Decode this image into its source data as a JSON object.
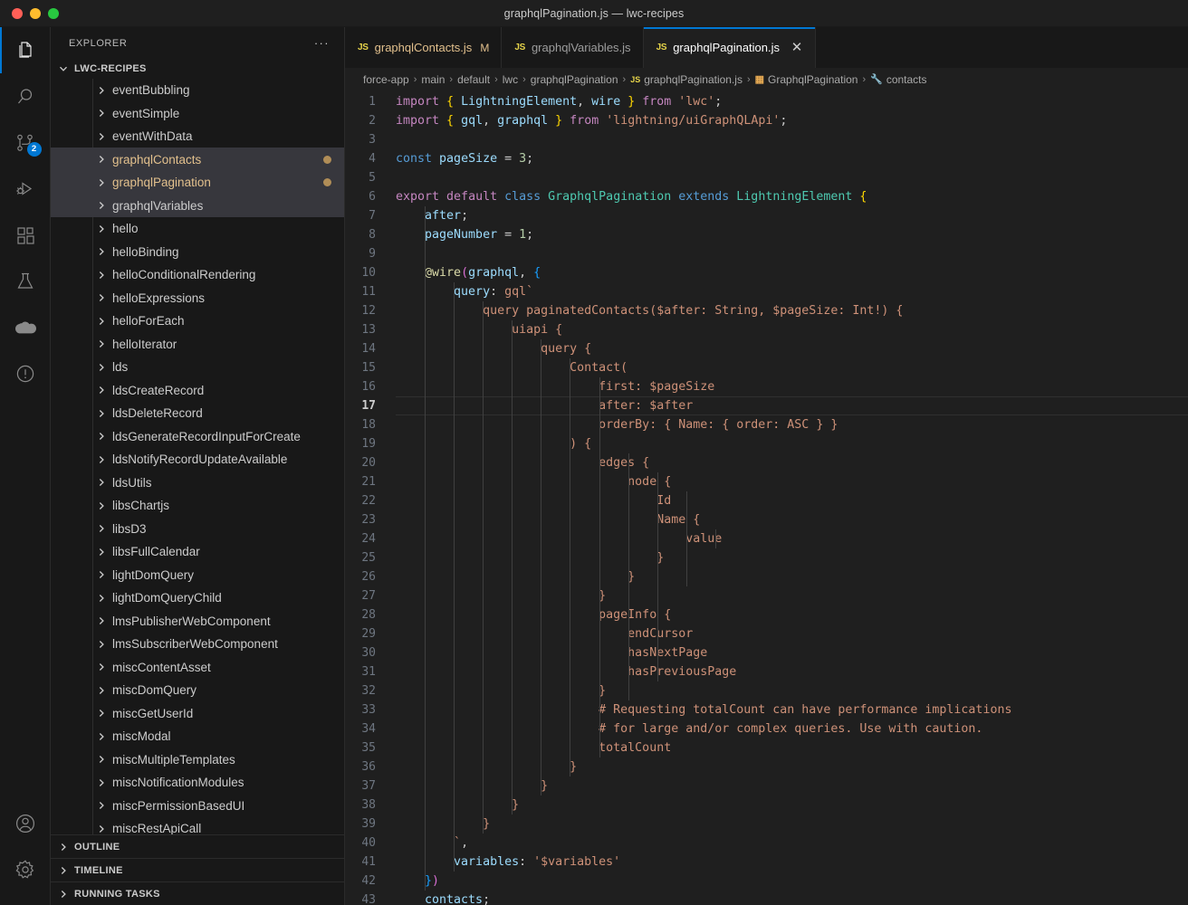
{
  "window": {
    "title": "graphqlPagination.js — lwc-recipes",
    "traffic_lights": [
      "close",
      "minimize",
      "maximize"
    ]
  },
  "activity_bar": {
    "top_items": [
      {
        "name": "explorer",
        "icon": "files-icon",
        "active": true,
        "badge": null
      },
      {
        "name": "search",
        "icon": "search-icon",
        "active": false,
        "badge": null
      },
      {
        "name": "source-control",
        "icon": "source-control-icon",
        "active": false,
        "badge": "2"
      },
      {
        "name": "run-and-debug",
        "icon": "run-debug-icon",
        "active": false,
        "badge": null
      },
      {
        "name": "extensions",
        "icon": "extensions-icon",
        "active": false,
        "badge": null
      },
      {
        "name": "testing",
        "icon": "beaker-icon",
        "active": false,
        "badge": null
      },
      {
        "name": "salesforce",
        "icon": "cloud-icon",
        "active": false,
        "badge": null
      },
      {
        "name": "problems",
        "icon": "warning-circle-icon",
        "active": false,
        "badge": null
      }
    ],
    "bottom_items": [
      {
        "name": "accounts",
        "icon": "account-icon"
      },
      {
        "name": "manage",
        "icon": "gear-icon"
      }
    ]
  },
  "sidebar": {
    "header_title": "EXPLORER",
    "more_actions": "···",
    "root_folder": "LWC-RECIPES",
    "tree_items": [
      {
        "label": "eventBubbling",
        "modified": false,
        "selected": false,
        "dot": false
      },
      {
        "label": "eventSimple",
        "modified": false,
        "selected": false,
        "dot": false
      },
      {
        "label": "eventWithData",
        "modified": false,
        "selected": false,
        "dot": false
      },
      {
        "label": "graphqlContacts",
        "modified": true,
        "selected": true,
        "dot": true
      },
      {
        "label": "graphqlPagination",
        "modified": true,
        "selected": true,
        "dot": true
      },
      {
        "label": "graphqlVariables",
        "modified": false,
        "selected": true,
        "dot": false
      },
      {
        "label": "hello",
        "modified": false,
        "selected": false,
        "dot": false
      },
      {
        "label": "helloBinding",
        "modified": false,
        "selected": false,
        "dot": false
      },
      {
        "label": "helloConditionalRendering",
        "modified": false,
        "selected": false,
        "dot": false
      },
      {
        "label": "helloExpressions",
        "modified": false,
        "selected": false,
        "dot": false
      },
      {
        "label": "helloForEach",
        "modified": false,
        "selected": false,
        "dot": false
      },
      {
        "label": "helloIterator",
        "modified": false,
        "selected": false,
        "dot": false
      },
      {
        "label": "lds",
        "modified": false,
        "selected": false,
        "dot": false
      },
      {
        "label": "ldsCreateRecord",
        "modified": false,
        "selected": false,
        "dot": false
      },
      {
        "label": "ldsDeleteRecord",
        "modified": false,
        "selected": false,
        "dot": false
      },
      {
        "label": "ldsGenerateRecordInputForCreate",
        "modified": false,
        "selected": false,
        "dot": false
      },
      {
        "label": "ldsNotifyRecordUpdateAvailable",
        "modified": false,
        "selected": false,
        "dot": false
      },
      {
        "label": "ldsUtils",
        "modified": false,
        "selected": false,
        "dot": false
      },
      {
        "label": "libsChartjs",
        "modified": false,
        "selected": false,
        "dot": false
      },
      {
        "label": "libsD3",
        "modified": false,
        "selected": false,
        "dot": false
      },
      {
        "label": "libsFullCalendar",
        "modified": false,
        "selected": false,
        "dot": false
      },
      {
        "label": "lightDomQuery",
        "modified": false,
        "selected": false,
        "dot": false
      },
      {
        "label": "lightDomQueryChild",
        "modified": false,
        "selected": false,
        "dot": false
      },
      {
        "label": "lmsPublisherWebComponent",
        "modified": false,
        "selected": false,
        "dot": false
      },
      {
        "label": "lmsSubscriberWebComponent",
        "modified": false,
        "selected": false,
        "dot": false
      },
      {
        "label": "miscContentAsset",
        "modified": false,
        "selected": false,
        "dot": false
      },
      {
        "label": "miscDomQuery",
        "modified": false,
        "selected": false,
        "dot": false
      },
      {
        "label": "miscGetUserId",
        "modified": false,
        "selected": false,
        "dot": false
      },
      {
        "label": "miscModal",
        "modified": false,
        "selected": false,
        "dot": false
      },
      {
        "label": "miscMultipleTemplates",
        "modified": false,
        "selected": false,
        "dot": false
      },
      {
        "label": "miscNotificationModules",
        "modified": false,
        "selected": false,
        "dot": false
      },
      {
        "label": "miscPermissionBasedUI",
        "modified": false,
        "selected": false,
        "dot": false
      },
      {
        "label": "miscRestApiCall",
        "modified": false,
        "selected": false,
        "dot": false
      }
    ],
    "footer_sections": [
      "OUTLINE",
      "TIMELINE",
      "RUNNING TASKS"
    ]
  },
  "tabs": [
    {
      "label": "graphqlContacts.js",
      "icon": "js-icon",
      "badge": "M",
      "active": false,
      "modified": true,
      "closable": false
    },
    {
      "label": "graphqlVariables.js",
      "icon": "js-icon",
      "badge": "",
      "active": false,
      "modified": false,
      "closable": false
    },
    {
      "label": "graphqlPagination.js",
      "icon": "js-icon",
      "badge": "",
      "active": true,
      "modified": false,
      "closable": true
    }
  ],
  "breadcrumb": [
    {
      "label": "force-app",
      "icon": ""
    },
    {
      "label": "main",
      "icon": ""
    },
    {
      "label": "default",
      "icon": ""
    },
    {
      "label": "lwc",
      "icon": ""
    },
    {
      "label": "graphqlPagination",
      "icon": ""
    },
    {
      "label": "graphqlPagination.js",
      "icon": "js-icon"
    },
    {
      "label": "GraphqlPagination",
      "icon": "class-icon"
    },
    {
      "label": "contacts",
      "icon": "field-icon"
    }
  ],
  "editor": {
    "current_line": 17,
    "close_label": "✕",
    "lines": [
      {
        "n": 1,
        "tokens": [
          {
            "t": "import ",
            "c": "t-kw"
          },
          {
            "t": "{",
            "c": "t-br1"
          },
          {
            "t": " LightningElement",
            "c": "t-var"
          },
          {
            "t": ", ",
            "c": "t-plain"
          },
          {
            "t": "wire ",
            "c": "t-var"
          },
          {
            "t": "}",
            "c": "t-br1"
          },
          {
            "t": " from ",
            "c": "t-kw"
          },
          {
            "t": "'lwc'",
            "c": "t-str"
          },
          {
            "t": ";",
            "c": "t-plain"
          }
        ]
      },
      {
        "n": 2,
        "tokens": [
          {
            "t": "import ",
            "c": "t-kw"
          },
          {
            "t": "{",
            "c": "t-br1"
          },
          {
            "t": " gql",
            "c": "t-var"
          },
          {
            "t": ", ",
            "c": "t-plain"
          },
          {
            "t": "graphql ",
            "c": "t-var"
          },
          {
            "t": "}",
            "c": "t-br1"
          },
          {
            "t": " from ",
            "c": "t-kw"
          },
          {
            "t": "'lightning/uiGraphQLApi'",
            "c": "t-str"
          },
          {
            "t": ";",
            "c": "t-plain"
          }
        ]
      },
      {
        "n": 3,
        "tokens": []
      },
      {
        "n": 4,
        "tokens": [
          {
            "t": "const ",
            "c": "t-kw2"
          },
          {
            "t": "pageSize",
            "c": "t-var"
          },
          {
            "t": " = ",
            "c": "t-plain"
          },
          {
            "t": "3",
            "c": "t-num"
          },
          {
            "t": ";",
            "c": "t-plain"
          }
        ]
      },
      {
        "n": 5,
        "tokens": []
      },
      {
        "n": 6,
        "tokens": [
          {
            "t": "export ",
            "c": "t-kw"
          },
          {
            "t": "default ",
            "c": "t-kw"
          },
          {
            "t": "class ",
            "c": "t-kw2"
          },
          {
            "t": "GraphqlPagination",
            "c": "t-cls"
          },
          {
            "t": " extends ",
            "c": "t-kw2"
          },
          {
            "t": "LightningElement",
            "c": "t-cls"
          },
          {
            "t": " ",
            "c": "t-plain"
          },
          {
            "t": "{",
            "c": "t-br1"
          }
        ]
      },
      {
        "n": 7,
        "tokens": [
          {
            "t": "    after",
            "c": "t-var"
          },
          {
            "t": ";",
            "c": "t-plain"
          }
        ]
      },
      {
        "n": 8,
        "tokens": [
          {
            "t": "    pageNumber",
            "c": "t-var"
          },
          {
            "t": " = ",
            "c": "t-plain"
          },
          {
            "t": "1",
            "c": "t-num"
          },
          {
            "t": ";",
            "c": "t-plain"
          }
        ]
      },
      {
        "n": 9,
        "tokens": []
      },
      {
        "n": 10,
        "tokens": [
          {
            "t": "    @wire",
            "c": "t-fn"
          },
          {
            "t": "(",
            "c": "t-br2"
          },
          {
            "t": "graphql",
            "c": "t-var"
          },
          {
            "t": ", ",
            "c": "t-plain"
          },
          {
            "t": "{",
            "c": "t-br3"
          }
        ]
      },
      {
        "n": 11,
        "tokens": [
          {
            "t": "        query",
            "c": "t-var"
          },
          {
            "t": ": ",
            "c": "t-plain"
          },
          {
            "t": "gql`",
            "c": "t-str"
          }
        ]
      },
      {
        "n": 12,
        "tokens": [
          {
            "t": "            query paginatedContacts($after: String, $pageSize: Int!) {",
            "c": "t-gql"
          }
        ]
      },
      {
        "n": 13,
        "tokens": [
          {
            "t": "                uiapi {",
            "c": "t-gql"
          }
        ]
      },
      {
        "n": 14,
        "tokens": [
          {
            "t": "                    query {",
            "c": "t-gql"
          }
        ]
      },
      {
        "n": 15,
        "tokens": [
          {
            "t": "                        Contact(",
            "c": "t-gql"
          }
        ]
      },
      {
        "n": 16,
        "tokens": [
          {
            "t": "                            first: $pageSize",
            "c": "t-gql"
          }
        ]
      },
      {
        "n": 17,
        "tokens": [
          {
            "t": "                            after: $after",
            "c": "t-gql"
          }
        ]
      },
      {
        "n": 18,
        "tokens": [
          {
            "t": "                            orderBy: { Name: { order: ASC } }",
            "c": "t-gql"
          }
        ]
      },
      {
        "n": 19,
        "tokens": [
          {
            "t": "                        ) {",
            "c": "t-gql"
          }
        ]
      },
      {
        "n": 20,
        "tokens": [
          {
            "t": "                            edges {",
            "c": "t-gql"
          }
        ]
      },
      {
        "n": 21,
        "tokens": [
          {
            "t": "                                node {",
            "c": "t-gql"
          }
        ]
      },
      {
        "n": 22,
        "tokens": [
          {
            "t": "                                    Id",
            "c": "t-gql"
          }
        ]
      },
      {
        "n": 23,
        "tokens": [
          {
            "t": "                                    Name {",
            "c": "t-gql"
          }
        ]
      },
      {
        "n": 24,
        "tokens": [
          {
            "t": "                                        value",
            "c": "t-gql"
          }
        ]
      },
      {
        "n": 25,
        "tokens": [
          {
            "t": "                                    }",
            "c": "t-gql"
          }
        ]
      },
      {
        "n": 26,
        "tokens": [
          {
            "t": "                                }",
            "c": "t-gql"
          }
        ]
      },
      {
        "n": 27,
        "tokens": [
          {
            "t": "                            }",
            "c": "t-gql"
          }
        ]
      },
      {
        "n": 28,
        "tokens": [
          {
            "t": "                            pageInfo {",
            "c": "t-gql"
          }
        ]
      },
      {
        "n": 29,
        "tokens": [
          {
            "t": "                                endCursor",
            "c": "t-gql"
          }
        ]
      },
      {
        "n": 30,
        "tokens": [
          {
            "t": "                                hasNextPage",
            "c": "t-gql"
          }
        ]
      },
      {
        "n": 31,
        "tokens": [
          {
            "t": "                                hasPreviousPage",
            "c": "t-gql"
          }
        ]
      },
      {
        "n": 32,
        "tokens": [
          {
            "t": "                            }",
            "c": "t-gql"
          }
        ]
      },
      {
        "n": 33,
        "tokens": [
          {
            "t": "                            # Requesting totalCount can have performance implications",
            "c": "t-gql"
          }
        ]
      },
      {
        "n": 34,
        "tokens": [
          {
            "t": "                            # for large and/or complex queries. Use with caution.",
            "c": "t-gql"
          }
        ]
      },
      {
        "n": 35,
        "tokens": [
          {
            "t": "                            totalCount",
            "c": "t-gql"
          }
        ]
      },
      {
        "n": 36,
        "tokens": [
          {
            "t": "                        }",
            "c": "t-gql"
          }
        ]
      },
      {
        "n": 37,
        "tokens": [
          {
            "t": "                    }",
            "c": "t-gql"
          }
        ]
      },
      {
        "n": 38,
        "tokens": [
          {
            "t": "                }",
            "c": "t-gql"
          }
        ]
      },
      {
        "n": 39,
        "tokens": [
          {
            "t": "            }",
            "c": "t-gql"
          }
        ]
      },
      {
        "n": 40,
        "tokens": [
          {
            "t": "        `",
            "c": "t-str"
          },
          {
            "t": ",",
            "c": "t-plain"
          }
        ]
      },
      {
        "n": 41,
        "tokens": [
          {
            "t": "        variables",
            "c": "t-var"
          },
          {
            "t": ": ",
            "c": "t-plain"
          },
          {
            "t": "'$variables'",
            "c": "t-str"
          }
        ]
      },
      {
        "n": 42,
        "tokens": [
          {
            "t": "    }",
            "c": "t-br3"
          },
          {
            "t": ")",
            "c": "t-br2"
          }
        ]
      },
      {
        "n": 43,
        "tokens": [
          {
            "t": "    contacts",
            "c": "t-var"
          },
          {
            "t": ";",
            "c": "t-plain"
          }
        ]
      }
    ]
  },
  "colors": {
    "accent": "#0078d4",
    "modified": "#e2c08d",
    "background": "#1f1f1f",
    "sidebar_bg": "#181818",
    "selection": "#37373d",
    "badge": "#0078d4"
  }
}
